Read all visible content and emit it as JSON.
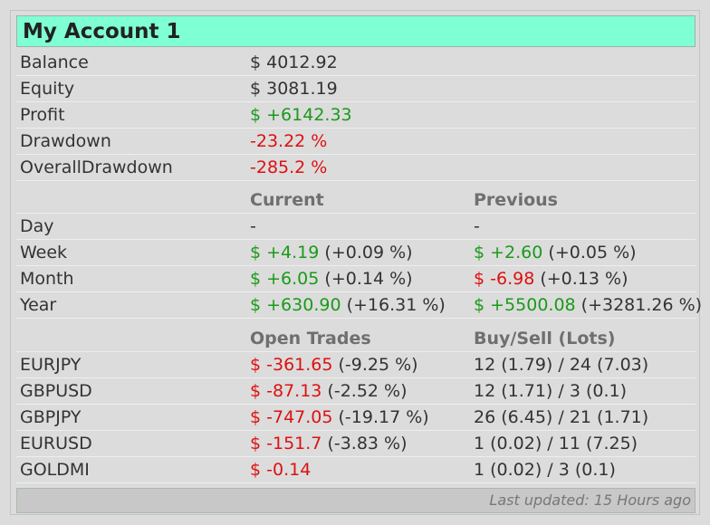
{
  "title": "My Account 1",
  "summary": [
    {
      "label": "Balance",
      "value": "$ 4012.92",
      "color": "muted"
    },
    {
      "label": "Equity",
      "value": "$ 3081.19",
      "color": "muted"
    },
    {
      "label": "Profit",
      "value": "$ +6142.33",
      "color": "green"
    },
    {
      "label": "Drawdown",
      "value": "-23.22 %",
      "color": "red"
    },
    {
      "label": "OverallDrawdown",
      "value": "-285.2 %",
      "color": "red"
    }
  ],
  "periods_header": {
    "current": "Current",
    "previous": "Previous"
  },
  "periods": [
    {
      "label": "Day",
      "current": {
        "amount": "-",
        "pct": "",
        "color": "muted"
      },
      "previous": {
        "amount": "-",
        "pct": "",
        "color": "muted"
      }
    },
    {
      "label": "Week",
      "current": {
        "amount": "$ +4.19",
        "pct": "(+0.09 %)",
        "color": "green"
      },
      "previous": {
        "amount": "$ +2.60",
        "pct": "(+0.05 %)",
        "color": "green"
      }
    },
    {
      "label": "Month",
      "current": {
        "amount": "$ +6.05",
        "pct": "(+0.14 %)",
        "color": "green"
      },
      "previous": {
        "amount": "$ -6.98",
        "pct": "(+0.13 %)",
        "color": "red"
      }
    },
    {
      "label": "Year",
      "current": {
        "amount": "$ +630.90",
        "pct": "(+16.31 %)",
        "color": "green"
      },
      "previous": {
        "amount": "$ +5500.08",
        "pct": "(+3281.26 %)",
        "color": "green"
      }
    }
  ],
  "trades_header": {
    "open": "Open Trades",
    "buysell": "Buy/Sell (Lots)"
  },
  "trades": [
    {
      "symbol": "EURJPY",
      "amount": "$ -361.65",
      "pct": "(-9.25 %)",
      "color": "red",
      "lots": "12 (1.79) / 24 (7.03)"
    },
    {
      "symbol": "GBPUSD",
      "amount": "$ -87.13",
      "pct": "(-2.52 %)",
      "color": "red",
      "lots": "12 (1.71) / 3 (0.1)"
    },
    {
      "symbol": "GBPJPY",
      "amount": "$ -747.05",
      "pct": "(-19.17 %)",
      "color": "red",
      "lots": "26 (6.45) / 21 (1.71)"
    },
    {
      "symbol": "EURUSD",
      "amount": "$ -151.7",
      "pct": "(-3.83 %)",
      "color": "red",
      "lots": "1 (0.02) / 11 (7.25)"
    },
    {
      "symbol": "GOLDMI",
      "amount": "$ -0.14",
      "pct": "",
      "color": "red",
      "lots": "1 (0.02) / 3 (0.1)"
    }
  ],
  "footer": "Last updated: 15 Hours ago",
  "colors": {
    "title_bg": "#7fffd4",
    "green": "#1a9a1a",
    "red": "#dd1111",
    "header_gray": "#6f6f6f"
  }
}
